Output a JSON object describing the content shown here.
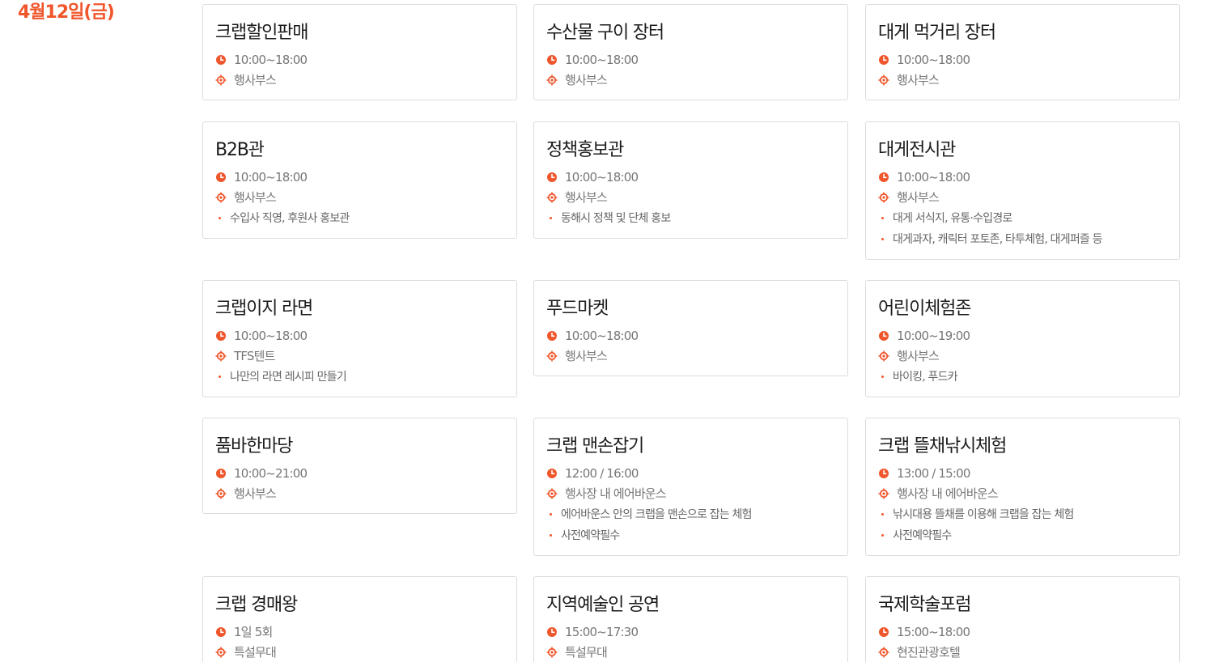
{
  "date": "4월12일(금)",
  "colors": {
    "accent": "#f0562b",
    "border": "#dcdcdc"
  },
  "icons": {
    "time": "clock-icon",
    "place": "location-target-icon",
    "bullet": "bullet-dot-icon"
  },
  "programs": [
    {
      "title": "크랩할인판매",
      "time": "10:00~18:00",
      "place": "행사부스",
      "notes": []
    },
    {
      "title": "수산물 구이 장터",
      "time": "10:00~18:00",
      "place": "행사부스",
      "notes": []
    },
    {
      "title": "대게 먹거리 장터",
      "time": "10:00~18:00",
      "place": "행사부스",
      "notes": []
    },
    {
      "title": "B2B관",
      "time": "10:00~18:00",
      "place": "행사부스",
      "notes": [
        "수입사 직영, 후원사 홍보관"
      ]
    },
    {
      "title": "정책홍보관",
      "time": "10:00~18:00",
      "place": "행사부스",
      "notes": [
        "동해시 정책 및 단체 홍보"
      ]
    },
    {
      "title": "대게전시관",
      "time": "10:00~18:00",
      "place": "행사부스",
      "notes": [
        "대게 서식지, 유통·수입경로",
        "대게과자, 캐릭터 포토존, 타투체험, 대게퍼즐 등"
      ]
    },
    {
      "title": "크랩이지 라면",
      "time": "10:00~18:00",
      "place": "TFS텐트",
      "notes": [
        "나만의 라면 레시피 만들기"
      ]
    },
    {
      "title": "푸드마켓",
      "time": "10:00~18:00",
      "place": "행사부스",
      "notes": []
    },
    {
      "title": "어린이체험존",
      "time": "10:00~19:00",
      "place": "행사부스",
      "notes": [
        "바이킹, 푸드카"
      ]
    },
    {
      "title": "품바한마당",
      "time": "10:00~21:00",
      "place": "행사부스",
      "notes": []
    },
    {
      "title": "크랩 맨손잡기",
      "time": "12:00 / 16:00",
      "place": "행사장 내 에어바운스",
      "notes": [
        "에어바운스 안의 크랩을 맨손으로 잡는 체험",
        "사전예약필수"
      ]
    },
    {
      "title": "크랩 뜰채낚시체험",
      "time": "13:00 / 15:00",
      "place": "행사장 내 에어바운스",
      "notes": [
        "낚시대용 뜰채를 이용해 크랩을 잡는 체험",
        "사전예약필수"
      ]
    },
    {
      "title": "크랩 경매왕",
      "time": "1일 5회",
      "place": "특설무대",
      "notes": []
    },
    {
      "title": "지역예술인 공연",
      "time": "15:00~17:30",
      "place": "특설무대",
      "notes": []
    },
    {
      "title": "국제학술포럼",
      "time": "15:00~18:00",
      "place": "현진관광호텔",
      "notes": []
    }
  ]
}
